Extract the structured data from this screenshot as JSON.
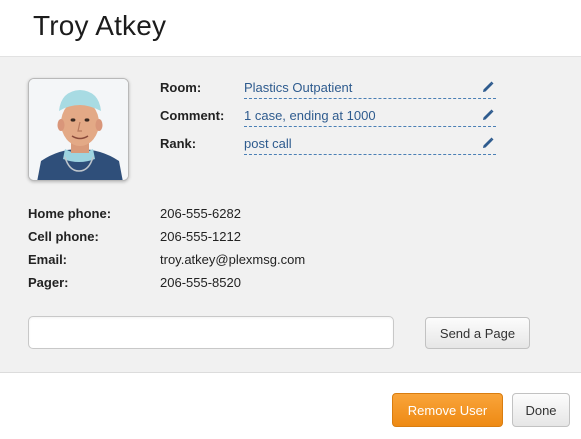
{
  "user": {
    "name": "Troy Atkey"
  },
  "fields": [
    {
      "label": "Room:",
      "value": "Plastics Outpatient"
    },
    {
      "label": "Comment:",
      "value": "1 case, ending at 1000"
    },
    {
      "label": "Rank:",
      "value": "post call"
    }
  ],
  "contact": [
    {
      "label": "Home phone:",
      "value": "206-555-6282"
    },
    {
      "label": "Cell phone:",
      "value": "206-555-1212"
    },
    {
      "label": "Email:",
      "value": "troy.atkey@plexmsg.com"
    },
    {
      "label": "Pager:",
      "value": "206-555-8520"
    }
  ],
  "page": {
    "placeholder": "",
    "send_label": "Send a Page"
  },
  "footer": {
    "remove_label": "Remove User",
    "done_label": "Done"
  },
  "colors": {
    "accent_orange": "#f0901c",
    "link_blue": "#2e5b8e",
    "panel_gray": "#f1f1f1"
  }
}
